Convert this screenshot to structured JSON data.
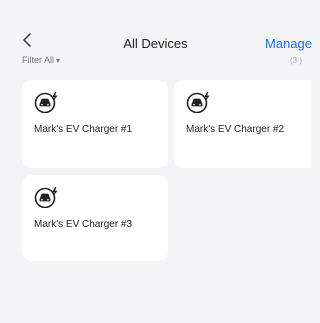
{
  "header": {
    "title": "All Devices",
    "manage_label": "Manage"
  },
  "filter": {
    "label": "Filter All",
    "count": "(3 )"
  },
  "devices": [
    {
      "name": "Mark's EV Charger #1"
    },
    {
      "name": "Mark's EV Charger #2"
    },
    {
      "name": "Mark's EV Charger #3"
    }
  ],
  "icons": {
    "back": "chevron-left-icon",
    "device": "ev-charger-car-icon"
  },
  "colors": {
    "accent": "#1f6feb",
    "background": "#f4f4f6",
    "card": "#ffffff"
  }
}
